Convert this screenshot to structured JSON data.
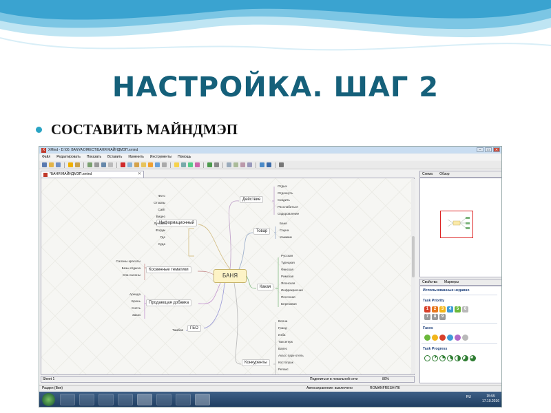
{
  "slide": {
    "title": "НАСТРОЙКА. ШАГ 2",
    "bullet": "СОСТАВИТЬ МАЙНДМЭП"
  },
  "window": {
    "title": "XMind - D:\\00. BANYA DIRECT\\БАНЯ МАЙНДМЭП.xmind",
    "icon_label": "X",
    "btn_min": "‒",
    "btn_max": "□",
    "btn_close": "✕"
  },
  "menu": [
    "Файл",
    "Редактировать",
    "Показать",
    "Вставить",
    "Изменить",
    "Инструменты",
    "Помощь"
  ],
  "editor": {
    "tab": "*БАНЯ МАЙНДМЭП.xmind",
    "tab_close": "✕"
  },
  "mindmap": {
    "central": "БАНЯ",
    "topics": {
      "action": "Действие",
      "info": "Информационный",
      "product": "Товар",
      "indirect": "Косвенные тематики",
      "which": "Какая",
      "sales": "Продающая добавка",
      "geo": "ГЕО",
      "competitors": "Конкуренты"
    },
    "action_items": [
      "Отдых",
      "Отдохнуть",
      "Сходить",
      "Расслабиться",
      "Оздоровление"
    ],
    "info_items": [
      "Фото",
      "Отзывы",
      "Сайт",
      "Видео",
      "Лучшие",
      "Форум",
      "Где",
      "Куда"
    ],
    "product_items": [
      "Баня",
      "Сауна",
      "Хаммам"
    ],
    "indirect_items": [
      "Салоны красоты",
      "Базы отдыха",
      "Спа-салоны"
    ],
    "which_items": [
      "Русская",
      "Турецкая",
      "Финская",
      "Римская",
      "Японская",
      "Инфракрасная",
      "Песочная",
      "Березовая"
    ],
    "sales_items": [
      "Аренда",
      "Бронь",
      "Снять",
      "Заказ"
    ],
    "geo_items": [
      "Тамбов"
    ],
    "competitor_items": [
      "Волна",
      "Гранд",
      "Изба",
      "Тахсегерк",
      "Валес",
      "Акасс парк-отель",
      "Костопрак",
      "Релакс"
    ]
  },
  "panels": {
    "schema_tab": "Схема",
    "overview_tab": "Обзор",
    "props_tab": "Свойства",
    "markers_tab": "Маркеры",
    "recent": "Использованные недавно",
    "task_priority": "Task Priority",
    "faces": "Faces",
    "task_progress": "Task Progress",
    "priorities": [
      "1",
      "2",
      "3",
      "4",
      "5",
      "6",
      "7",
      "8",
      "9"
    ],
    "colors": {
      "p1": "#d8402a",
      "p2": "#e8781f",
      "p3": "#f2b51a",
      "p4": "#3f9bd6",
      "p5": "#6bb83b",
      "p6": "#b9b9b9",
      "p7": "#9a9a9a",
      "p8": "#9a9a9a",
      "p9": "#9a9a9a"
    }
  },
  "sheetbar": {
    "sheet": "Sheet 1",
    "share": "Поделиться в локальной сети",
    "zoom": "80%"
  },
  "statusbar": {
    "left": "Раздел (Вип)",
    "autosave": "Автосохранение: выключено",
    "machine": "ROMANFRESH-ПК"
  },
  "taskbar": {
    "lang": "RU",
    "time": "15:55",
    "date": "17.10.2016"
  }
}
